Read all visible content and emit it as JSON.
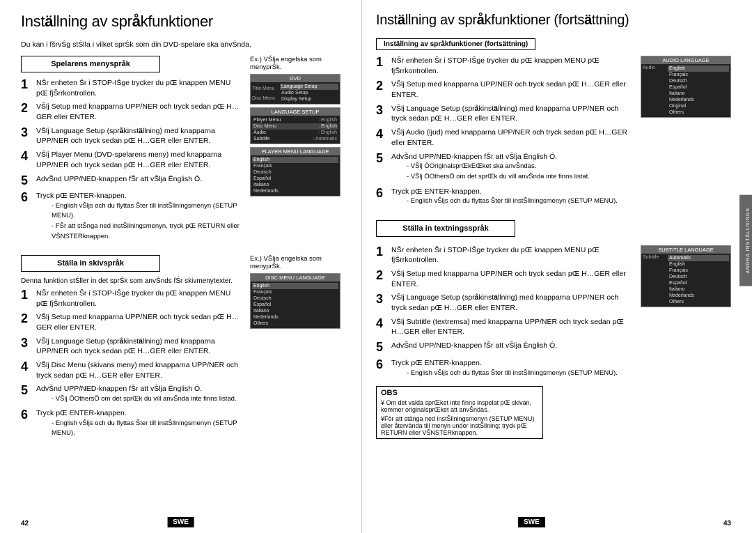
{
  "left": {
    "title": "Inst",
    "title_bold": "ä",
    "title_rest": "llning av spr",
    "title_bold2": "å",
    "title_rest2": "kfunktioner",
    "intro": "Du kan i fšrvŚg stŚlla i vilket sprŚk som din DVD-spelare ska anvŚnda.",
    "section1_header": "Spelarens menyspråk",
    "section1_example_caption": "Ex.) VŚlja engelska som menyprŚk.",
    "steps1": [
      {
        "num": "1",
        "text": "NŚr enheten Śr i STOP-IŚge trycker du pŚ knappen MENU pŚ fjŚrrkontrollen."
      },
      {
        "num": "2",
        "text": "VŚlj Setup med knapparna UPP/NER och tryck sedan pŚ H…GER eller ENTER."
      },
      {
        "num": "3",
        "text": "VŚlj Language Setup (språkinställning) med knapparna UPP/NER och tryck sedan pŚ H…GER eller ENTER."
      },
      {
        "num": "4",
        "text": "VŚlj Player Menu (DVD-spelarens meny) med knapparna UPP/NER och tryck sedan pŚ H…GER eller ENTER."
      },
      {
        "num": "5",
        "text": "AnvŚnd UPP/NED-knappen fŚr att vŚlja Ęnglish Ó."
      },
      {
        "num": "6",
        "text": "Tryck pŚ ENTER-knappen.",
        "notes": [
          "- English vŚljs och du flyttas Śter till instŚllningsmenyn (SETUP MENU).",
          "- FŚr att stŚnga ned instŚllningsmenyn, tryck pŚ RETURN eller VŚNSTER-knappen."
        ]
      }
    ],
    "section2_header": "Ställa in skivspråk",
    "section2_desc": "Denna funktion stŚller in det sprŚk som anvŚnds fŚr skivmenytexter.",
    "section2_example_caption": "Ex.) VŚlja engelska som menyprŚk.",
    "steps2": [
      {
        "num": "1",
        "text": "NŚr enheten Śr i STOP-IŚge trycker du pŚ knappen MENU pŚ fjŚrrkontrollen."
      },
      {
        "num": "2",
        "text": "VŚlj Setup med knapparna UPP/NER och tryck sedan pŚ H…GER eller ENTER."
      },
      {
        "num": "3",
        "text": "VŚlj Language Setup (språkinställning) med knapparna UPP/NER och tryck sedan pŚ H…GER eller ENTER."
      },
      {
        "num": "4",
        "text": "VŚlj Disc Menu (skivans meny) med knapparna UPP/NER och tryck sedan pŚ H…GER eller ENTER."
      },
      {
        "num": "5",
        "text": "AnvŚnd UPP/NED-knappen fŚr att vŚlja Ęnglish Ó.",
        "notes": [
          "- VŚlj ÖOthersÖ om det sprŚk du vill anvŚnda inte finns listat."
        ]
      },
      {
        "num": "6",
        "text": "Tryck pŚ ENTER-knappen.",
        "notes": [
          "- English vŚljs och du flyttas Śter till instŚllningsmenyn (SETUP MENU)."
        ]
      }
    ],
    "page_num": "42",
    "swe": "SWE"
  },
  "right": {
    "title": "Inst",
    "title_bold": "ä",
    "title_rest": "llning av spr",
    "title_bold2": "å",
    "title_rest2": "kfunktioner (forts",
    "title_bold3": "ä",
    "title_rest3": "ttning)",
    "section_header_box": "Inställning av språkfunktioner (fortsättning)",
    "steps1": [
      {
        "num": "1",
        "text": "NŚr enheten Śr i STOP-IŚge trycker du pŚ knappen MENU pŚ fjŚrrkontrollen."
      },
      {
        "num": "2",
        "text": "VŚlj Setup med knapparna UPP/NER och tryck sedan pŚ H…GER eller ENTER."
      },
      {
        "num": "3",
        "text": "VŚlj Language Setup (språkinställning) med knapparna UPP/NER och tryck sedan pŚ H…GER eller ENTER."
      },
      {
        "num": "4",
        "text": "VŚlj Audio (ljud) med knapparna UPP/NER och tryck sedan pŚ H…GER eller ENTER."
      },
      {
        "num": "5",
        "text": "AnvŚnd UPP/NED-knappen fŚr att vŚlja Ęnglish Ó.",
        "notes": [
          "- VŚlj ÖOriginalsprEŚkt ska anvŚndas.",
          "- VŚlj ÖOthersÖ om det sprŚk du vill anvŚnda inte finns listat."
        ]
      },
      {
        "num": "6",
        "text": "Tryck pŚ ENTER-knappen.",
        "notes": [
          "- English vŚljs och du flyttas Śter till instŚllningsmenyn (SETUP MENU)."
        ]
      }
    ],
    "section2_header": "Ställa in textningsspråk",
    "steps2": [
      {
        "num": "1",
        "text": "NŚr enheten Śr i STOP-IŚge trycker du pŚ knappen MENU pŚ fjŚrrkontrollen."
      },
      {
        "num": "2",
        "text": "VŚlj Setup med knapparna UPP/NER och tryck sedan pŚ H…GER eller ENTER."
      },
      {
        "num": "3",
        "text": "VŚlj Language Setup (språkinställning) med knapparna UPP/NER och tryck sedan pŚ H…GER eller ENTER."
      },
      {
        "num": "4",
        "text": "VŚlj Subtitle (textremsa) med knapparna UPP/NER och tryck sedan pŚ H…GER eller ENTER."
      },
      {
        "num": "5",
        "text": "AnvŚnd UPP/NED-knappen fŚr att vŚlja Ęnglish Ó."
      },
      {
        "num": "6",
        "text": "Tryck pŚ ENTER-knappen.",
        "notes": [
          "- English vŚljs och du flyttas Śter till instŚllningsmenyn (SETUP MENU)."
        ]
      }
    ],
    "obs_title": "OBS",
    "obs_notes": [
      "¥ Om det valda sprŚket inte finns inspelat pŚ skivan, kommer originalsprEŚkt att anvŚndas.",
      "¥För att stänga ned inställningsmenyn (SETUP MENU) eller återvEända till menyn under inställning; tryck pŚ RETURN eller VŚNSTER-knappen."
    ],
    "page_num": "43",
    "swe": "SWE",
    "sidebar_label": "ANDRA INSTÄLLNINGS"
  },
  "screens": {
    "language_setup_title": "LANGUAGE SETUP",
    "language_setup_items": [
      {
        "label": "Player Menu",
        "value": "English"
      },
      {
        "label": "Disc Menu",
        "value": "English"
      },
      {
        "label": "Audio",
        "value": "English"
      },
      {
        "label": "Subtitle",
        "value": "Automatic"
      }
    ],
    "player_menu_lang_title": "PLAYER MENU LANGUAGE",
    "player_lang_items": [
      "English",
      "Français",
      "Deutsch",
      "Español",
      "Italiano",
      "Nederlands"
    ],
    "player_lang_selected": "English",
    "disc_menu_lang_title": "DISC MENU LANGUAGE",
    "disc_lang_items": [
      "English",
      "Français",
      "Deutsch",
      "Español",
      "Italiano",
      "Nederlands",
      "Others"
    ],
    "disc_lang_selected": "English",
    "audio_lang_title": "AUDIO LANGUAGE",
    "audio_lang_items": [
      "English",
      "Français",
      "Deutsch",
      "Español",
      "Italiano",
      "Nederlands",
      "Original",
      "Others"
    ],
    "audio_lang_selected": "English",
    "subtitle_lang_title": "SUBTITLE LANGUAGE",
    "subtitle_lang_items": [
      "Automatic",
      "English",
      "Français",
      "Deutsch",
      "Español",
      "Italiano",
      "Nederlands",
      "Others"
    ],
    "subtitle_lang_selected": "Automatic",
    "dvd_menu_title": "DVD",
    "main_menu_items": [
      "Language Setup",
      "Audio Setup",
      "Display Setup"
    ],
    "main_menu_selected": "Language Setup"
  }
}
